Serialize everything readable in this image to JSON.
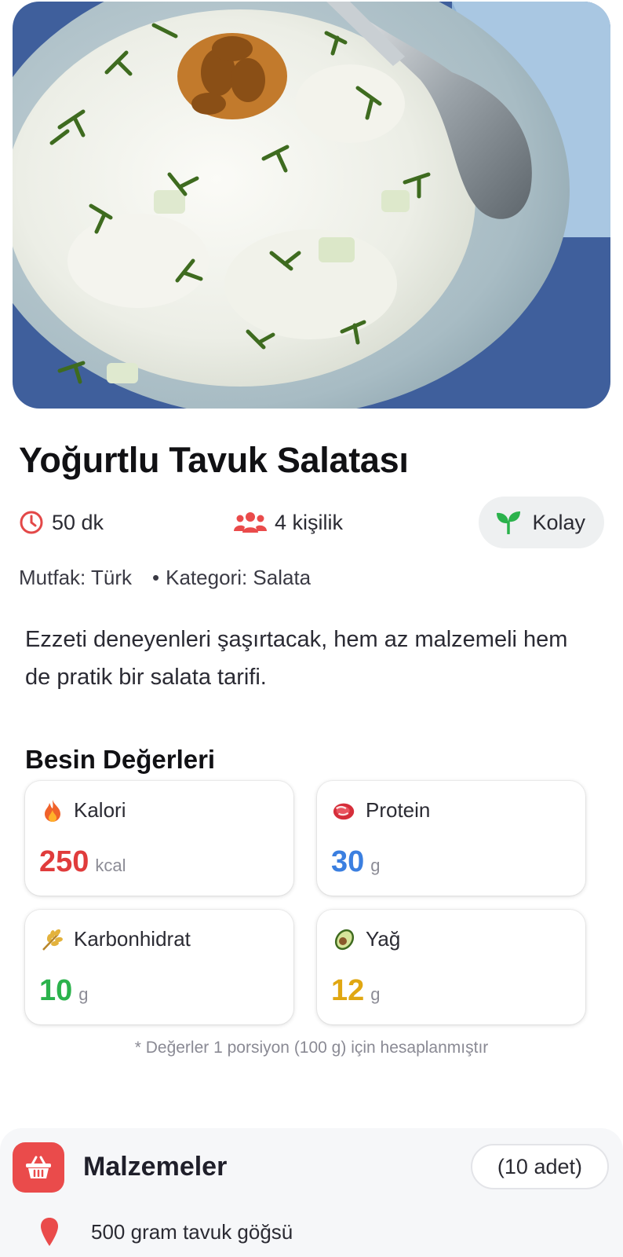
{
  "recipe": {
    "title": "Yoğurtlu Tavuk Salatası",
    "time": "50 dk",
    "servings": "4 kişilik",
    "difficulty": "Kolay",
    "cuisine": "Mutfak: Türk",
    "category": "Kategori: Salata",
    "description": "Ezzeti deneyenleri şaşırtacak, hem az malzemeli hem de pratik bir salata tarifi."
  },
  "nutrition": {
    "title": "Besin Değerleri",
    "items": [
      {
        "label": "Kalori",
        "value": "250",
        "unit": "kcal",
        "color": "#e03c3c",
        "icon": "fire-icon"
      },
      {
        "label": "Protein",
        "value": "30",
        "unit": "g",
        "color": "#3b7fe0",
        "icon": "meat-icon"
      },
      {
        "label": "Karbonhidrat",
        "value": "10",
        "unit": "g",
        "color": "#2bb24c",
        "icon": "wheat-icon"
      },
      {
        "label": "Yağ",
        "value": "12",
        "unit": "g",
        "color": "#e0a712",
        "icon": "avocado-icon"
      }
    ],
    "note": "* Değerler 1 porsiyon (100 g) için hesaplanmıştır"
  },
  "ingredients": {
    "title": "Malzemeler",
    "count": "(10 adet)",
    "first_item": "500 gram tavuk göğsü"
  },
  "colors": {
    "accent": "#ea4b4b",
    "clock": "#e34848",
    "people": "#ea4b4b",
    "sprout": "#2bb24c"
  }
}
